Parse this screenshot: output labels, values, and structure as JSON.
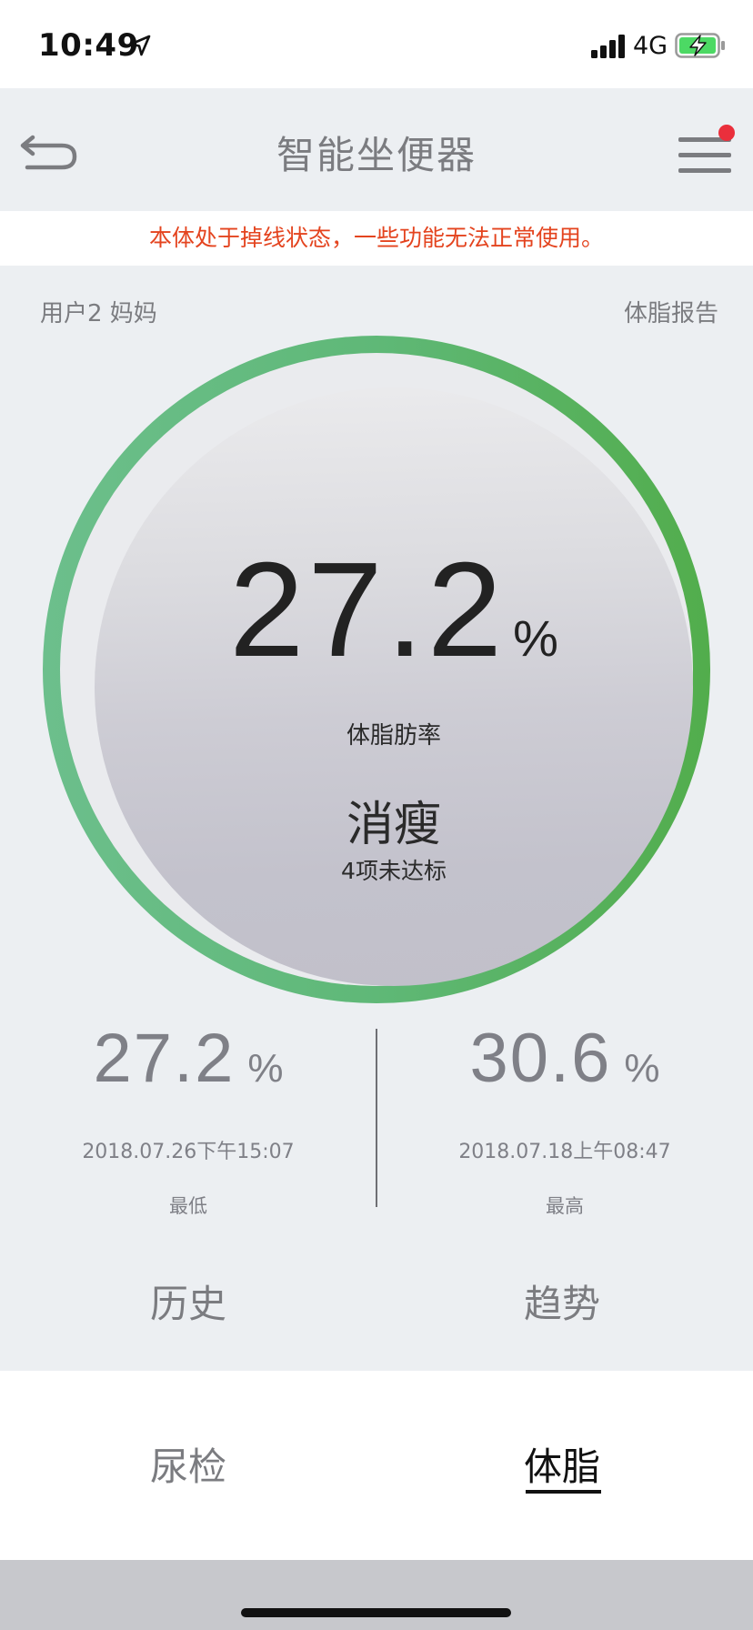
{
  "status_bar": {
    "time": "10:49",
    "network": "4G"
  },
  "nav": {
    "title": "智能坐便器"
  },
  "warning": {
    "text": "本体处于掉线状态，一些功能无法正常使用。"
  },
  "header": {
    "user": "用户2 妈妈",
    "report_link": "体脂报告"
  },
  "gauge": {
    "value": "27.2",
    "unit": "%",
    "label": "体脂肪率",
    "status": "消瘦",
    "status_detail": "4项未达标"
  },
  "stats": {
    "min": {
      "value": "27.2",
      "unit": "%",
      "date": "2018.07.26下午15:07",
      "caption": "最低"
    },
    "max": {
      "value": "30.6",
      "unit": "%",
      "date": "2018.07.18上午08:47",
      "caption": "最高"
    }
  },
  "actions": {
    "history": "历史",
    "trend": "趋势"
  },
  "tabs": {
    "urine": "尿检",
    "bodyfat": "体脂",
    "active": "体脂"
  },
  "colors": {
    "accent_green": "#52ad4c",
    "warning_red": "#e4441f",
    "notification_dot": "#ea2f3c",
    "battery_green": "#4cd964"
  },
  "icons": {
    "back": "back-arrow-icon",
    "menu": "hamburger-menu-icon",
    "location": "location-arrow-icon",
    "signal": "cellular-signal-icon",
    "battery": "battery-charging-icon"
  }
}
